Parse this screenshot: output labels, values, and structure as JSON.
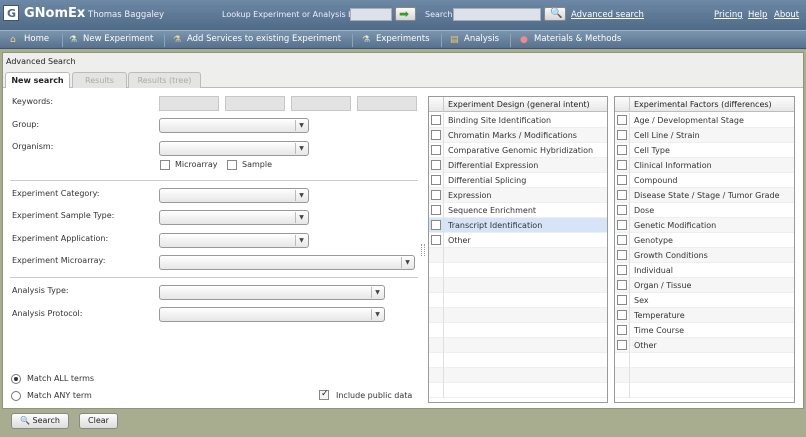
{
  "header": {
    "logo_letter": "G",
    "app_title": "GNomEx",
    "user_name": "Thomas Baggaley",
    "lookup_label": "Lookup Experiment or Analysis by #",
    "search_label": "Search",
    "advanced_link": "Advanced search",
    "pricing_link": "Pricing",
    "help_link": "Help",
    "about_link": "About",
    "go_icon": "➡",
    "search_icon": "🔍"
  },
  "nav": {
    "home": "Home",
    "new_experiment": "New Experiment",
    "add_services": "Add Services to existing Experiment",
    "experiments": "Experiments",
    "analysis": "Analysis",
    "materials": "Materials & Methods"
  },
  "panel": {
    "title": "Advanced Search",
    "tabs": [
      "New search",
      "Results",
      "Results (tree)"
    ]
  },
  "form": {
    "keywords_label": "Keywords:",
    "group_label": "Group:",
    "organism_label": "Organism:",
    "microarray_label": "Microarray",
    "sample_label": "Sample",
    "exp_category_label": "Experiment Category:",
    "exp_sample_type_label": "Experiment Sample Type:",
    "exp_application_label": "Experiment Application:",
    "exp_microarray_label": "Experiment Microarray:",
    "analysis_type_label": "Analysis Type:",
    "analysis_protocol_label": "Analysis Protocol:",
    "match_all_label": "Match ALL terms",
    "match_any_label": "Match ANY term",
    "include_public_label": "Include public data",
    "match_mode": "all",
    "include_public": true
  },
  "design_grid": {
    "header": "Experiment Design (general intent)",
    "rows": [
      "Binding Site Identification",
      "Chromatin Marks / Modifications",
      "Comparative Genomic Hybridization",
      "Differential Expression",
      "Differential Splicing",
      "Expression",
      "Sequence Enrichment",
      "Transcript Identification",
      "Other"
    ],
    "selected_index": 7
  },
  "factors_grid": {
    "header": "Experimental Factors (differences)",
    "rows": [
      "Age / Developmental Stage",
      "Cell Line / Strain",
      "Cell Type",
      "Clinical Information",
      "Compound",
      "Disease State / Stage / Tumor Grade",
      "Dose",
      "Genetic Modification",
      "Genotype",
      "Growth Conditions",
      "Individual",
      "Organ / Tissue",
      "Sex",
      "Temperature",
      "Time Course",
      "Other"
    ]
  },
  "buttons": {
    "search": "Search",
    "clear": "Clear"
  },
  "colors": {
    "header_bg": "#5a7794",
    "nav_bg": "#6a84a0",
    "frame_bg": "#a9ad8f",
    "selected_row": "#d5e4f6"
  }
}
